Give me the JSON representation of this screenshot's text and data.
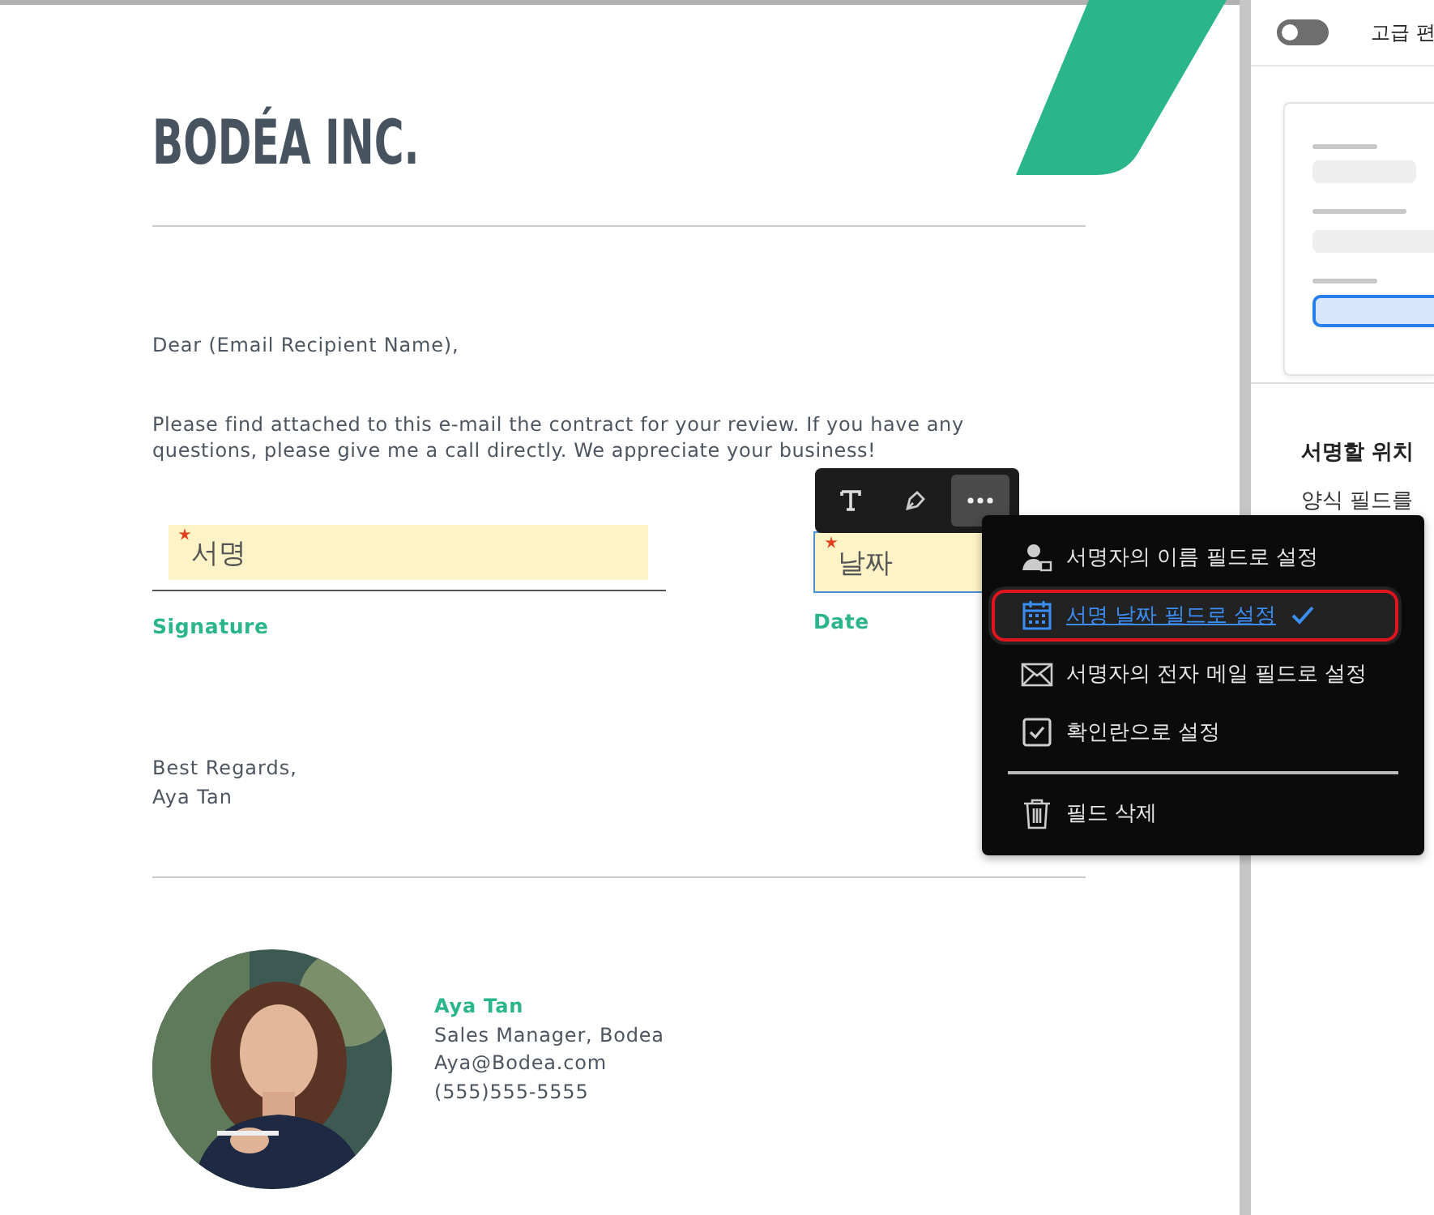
{
  "document": {
    "logo": "BODÉA INC.",
    "greeting": "Dear (Email Recipient Name),",
    "body": "Please find attached to this e-mail the contract for your review. If you have any questions, please give me a call directly. We appreciate your business!",
    "fields": [
      {
        "placeholder": "서명",
        "required": true,
        "label": "Signature",
        "selected": false
      },
      {
        "placeholder": "날짜",
        "required": true,
        "label": "Date",
        "selected": true
      }
    ],
    "closing": [
      "Best Regards,",
      "Aya Tan"
    ],
    "contact": {
      "name": "Aya Tan",
      "title": "Sales Manager, Bodea",
      "email": "Aya@Bodea.com",
      "phone": "(555)555-5555"
    }
  },
  "field_toolbar": {
    "tools": [
      {
        "kind": "text",
        "selected": false
      },
      {
        "kind": "pen",
        "selected": false
      },
      {
        "kind": "more",
        "selected": true
      }
    ]
  },
  "field_menu": {
    "items": [
      {
        "kind": "name",
        "label": "서명자의 이름 필드로 설정",
        "selected": false
      },
      {
        "kind": "date",
        "label": "서명 날짜 필드로 설정",
        "selected": true
      },
      {
        "kind": "email",
        "label": "서명자의 전자 메일 필드로 설정",
        "selected": false
      },
      {
        "kind": "checkbox",
        "label": "확인란으로 설정",
        "selected": false
      },
      {
        "kind": "delete",
        "label": "필드 삭제",
        "selected": false
      }
    ]
  },
  "side_panel": {
    "toggle": {
      "label": "고급 편",
      "on": false
    },
    "heading": "서명할 위치",
    "text": "양식 필드를"
  }
}
